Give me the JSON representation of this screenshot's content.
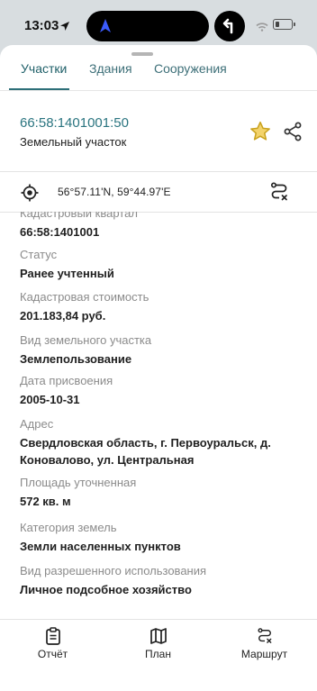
{
  "status_bar": {
    "time": "13:03"
  },
  "tabs": [
    {
      "label": "Участки",
      "active": true
    },
    {
      "label": "Здания",
      "active": false
    },
    {
      "label": "Сооружения",
      "active": false
    }
  ],
  "parcel": {
    "cadastral_number": "66:58:1401001:50",
    "type": "Земельный участок"
  },
  "coordinates": {
    "text": "56°57.11'N, 59°44.97'E"
  },
  "fields": [
    {
      "label": "Кадастровый квартал",
      "value": "66:58:1401001"
    },
    {
      "label": "Статус",
      "value": "Ранее учтенный"
    },
    {
      "label": "Кадастровая стоимость",
      "value": "201.183,84 руб."
    },
    {
      "label": "Вид земельного участка",
      "value": "Землепользование"
    },
    {
      "label": "Дата присвоения",
      "value": "2005-10-31"
    },
    {
      "label": "Адрес",
      "value": "Свердловская область, г. Первоуральск, д. Коновалово, ул. Центральная"
    },
    {
      "label": "Площадь уточненная",
      "value": "572 кв. м"
    },
    {
      "label": "Категория земель",
      "value": "Земли населенных пунктов"
    },
    {
      "label": "Вид разрешенного использования",
      "value": "Личное подсобное хозяйство"
    }
  ],
  "bottom_bar": {
    "report": "Отчёт",
    "plan": "План",
    "route": "Маршрут"
  },
  "colors": {
    "accent": "#2b7580",
    "star": "#e7b928"
  }
}
